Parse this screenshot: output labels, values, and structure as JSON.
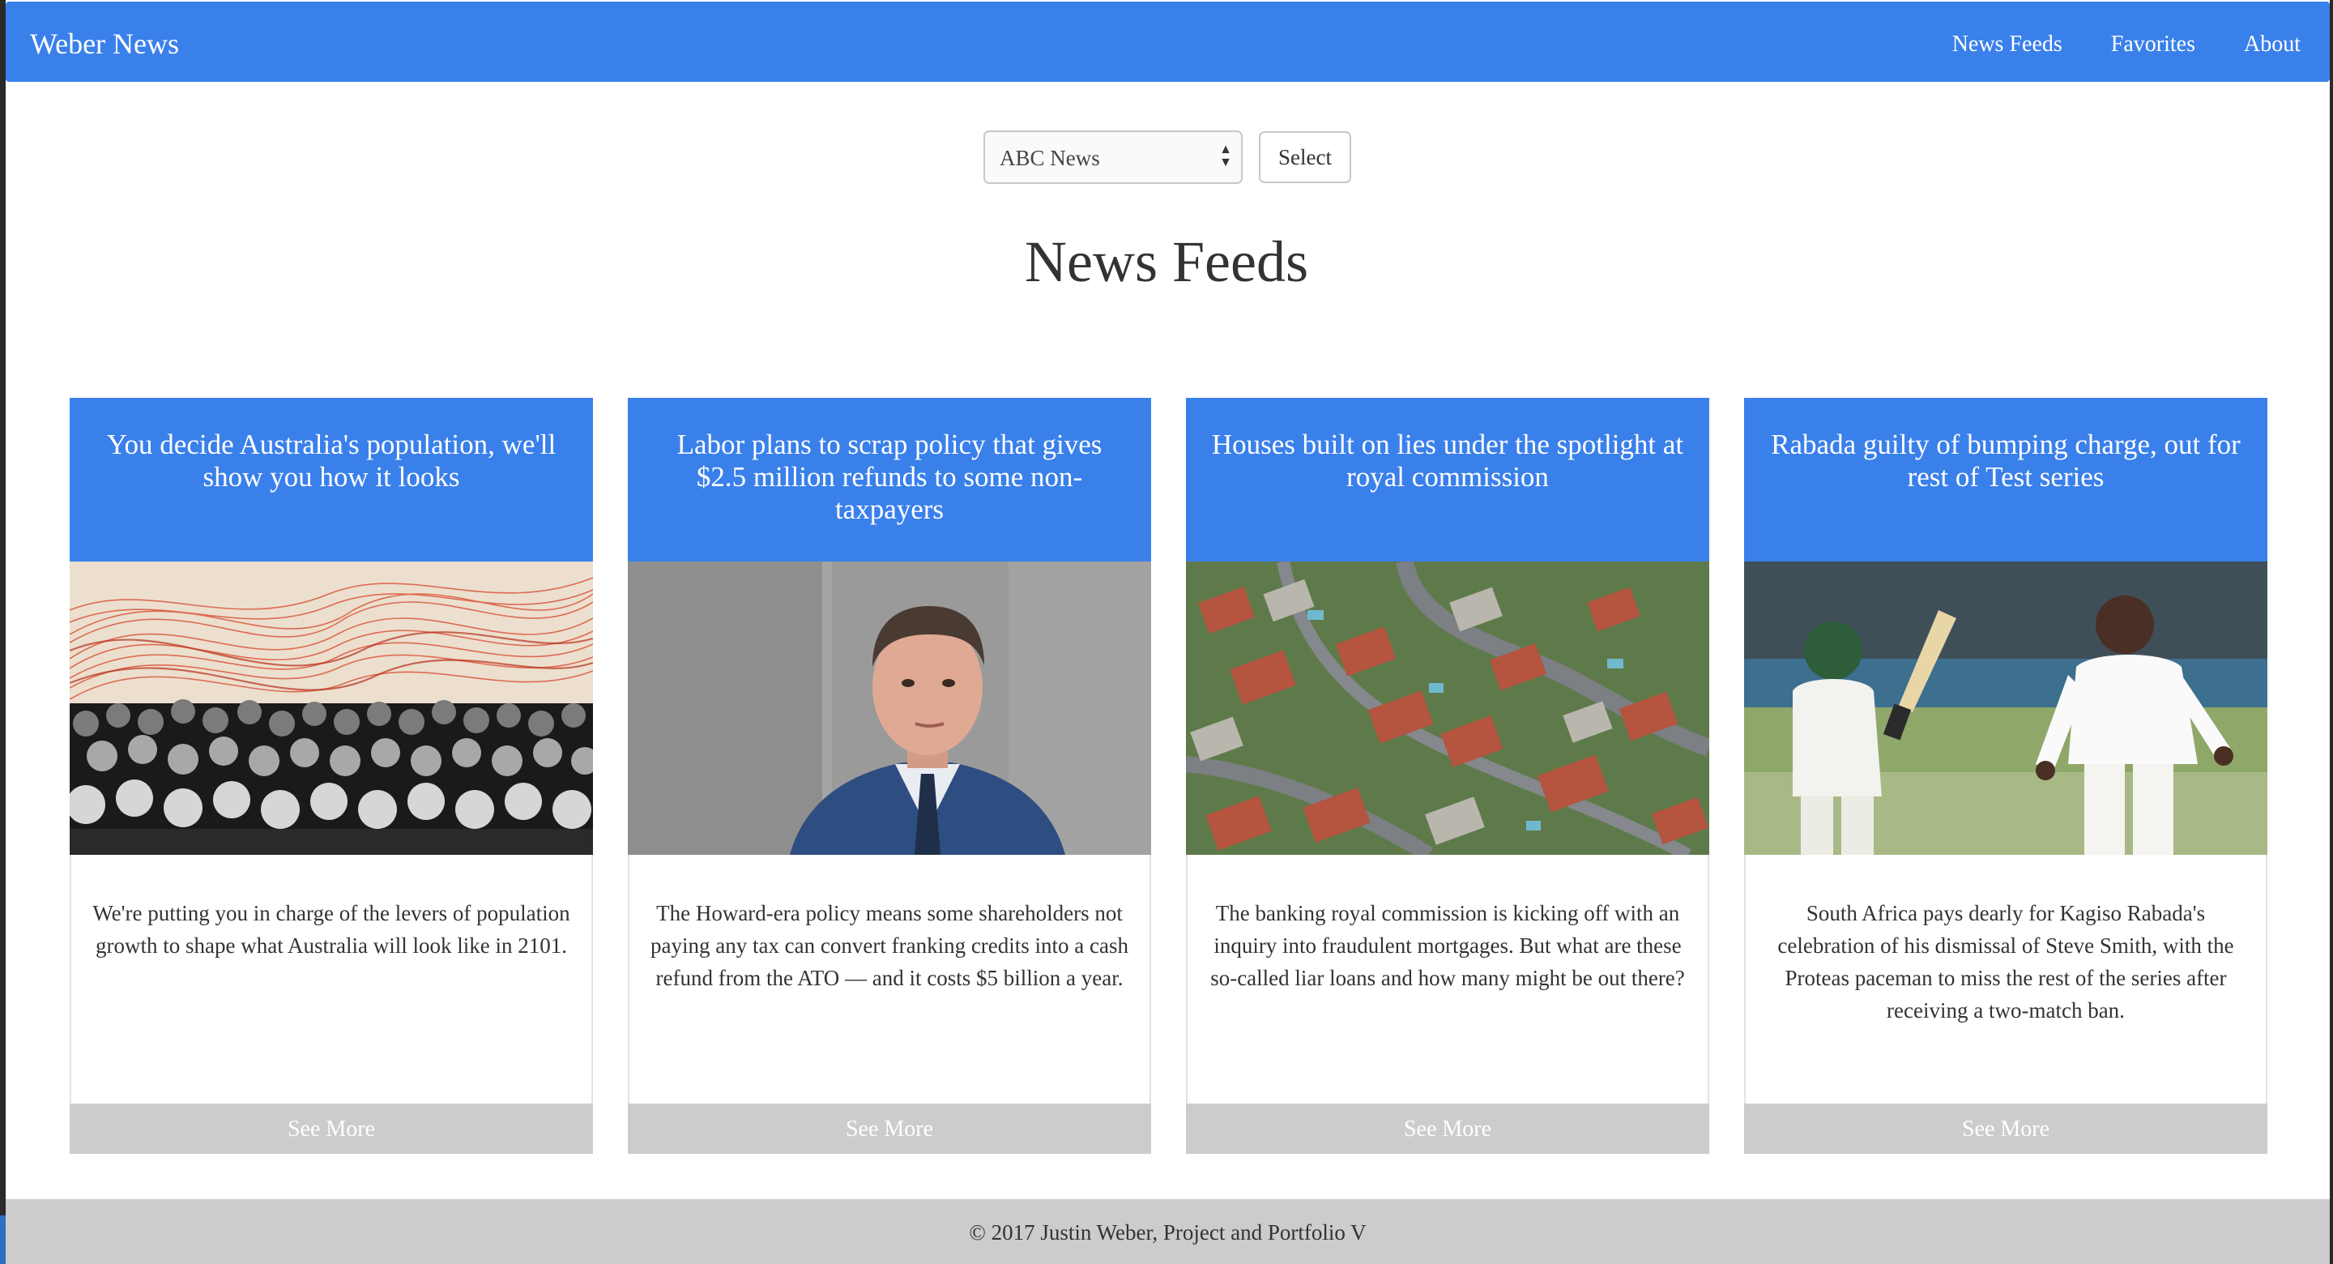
{
  "navbar": {
    "brand": "Weber News",
    "links": [
      {
        "label": "News Feeds"
      },
      {
        "label": "Favorites"
      },
      {
        "label": "About"
      }
    ]
  },
  "controls": {
    "source_select_value": "ABC News",
    "select_button_label": "Select"
  },
  "main": {
    "title": "News Feeds",
    "cards": [
      {
        "headline": "You decide Australia's population, we'll show you how it looks",
        "image": "crowd-with-red-waves-illustration",
        "description": "We're putting you in charge of the levers of population growth to shape what Australia will look like in 2101.",
        "button_label": "See More"
      },
      {
        "headline": "Labor plans to scrap policy that gives $2.5 million refunds to some non-taxpayers",
        "image": "man-in-suit-portrait-photo",
        "description": "The Howard-era policy means some shareholders not paying any tax can convert franking credits into a cash refund from the ATO — and it costs $5 billion a year.",
        "button_label": "See More"
      },
      {
        "headline": "Houses built on lies under the spotlight at royal commission",
        "image": "aerial-suburb-houses-photo",
        "description": "The banking royal commission is kicking off with an inquiry into fraudulent mortgages. But what are these so-called liar loans and how many might be out there?",
        "button_label": "See More"
      },
      {
        "headline": "Rabada guilty of bumping charge, out for rest of Test series",
        "image": "cricket-players-photo",
        "description": "South Africa pays dearly for Kagiso Rabada's celebration of his dismissal of Steve Smith, with the Proteas paceman to miss the rest of the series after receiving a two-match ban.",
        "button_label": "See More"
      }
    ]
  },
  "footer": {
    "text": "© 2017 Justin Weber, Project and Portfolio V"
  },
  "colors": {
    "primary": "#3a80eb",
    "button_grey": "#cccccc",
    "footer_grey": "#cccccc",
    "text": "#333333"
  }
}
